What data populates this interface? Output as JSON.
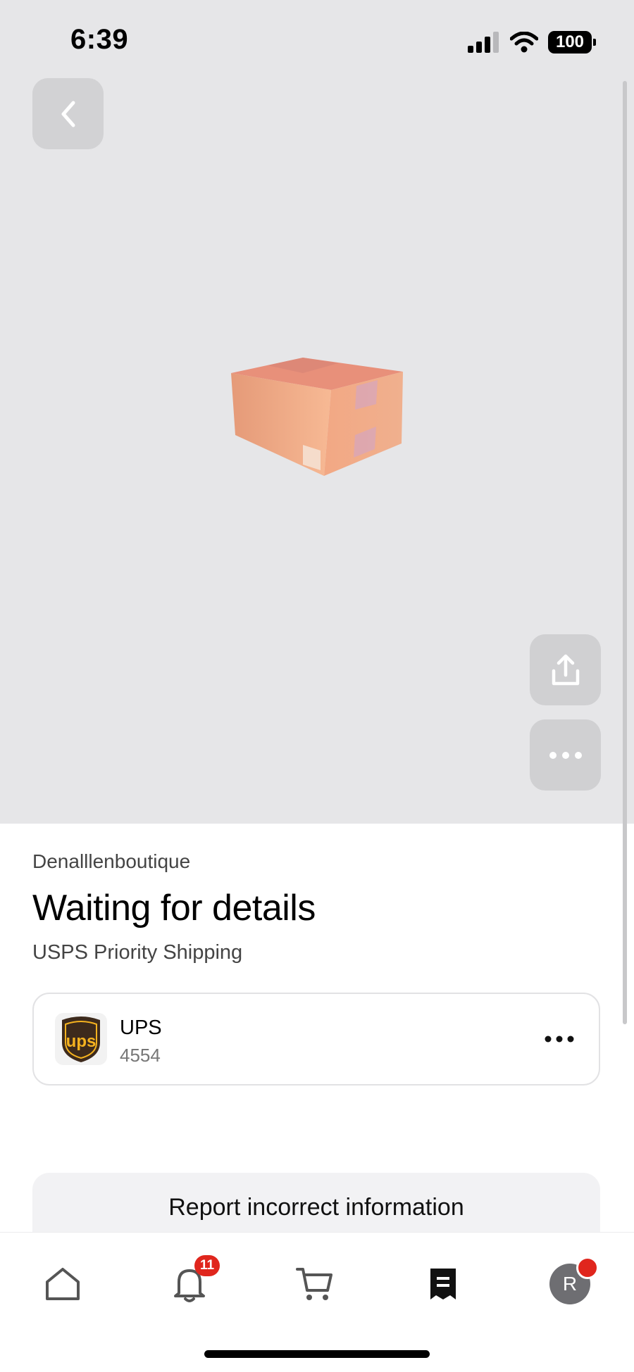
{
  "status_bar": {
    "time": "6:39",
    "battery": "100"
  },
  "header": {
    "back_icon": "chevron-left-icon",
    "share_icon": "share-icon",
    "more_icon": "ellipsis-icon"
  },
  "shipment": {
    "seller": "Denalllenboutique",
    "status": "Waiting for details",
    "shipping_method": "USPS Priority Shipping"
  },
  "carrier": {
    "name": "UPS",
    "tracking": "4554",
    "logo_text": "ups",
    "menu_icon": "ellipsis-icon"
  },
  "actions": {
    "report_label": "Report incorrect information"
  },
  "tab_bar": {
    "items": [
      {
        "icon": "home-icon"
      },
      {
        "icon": "bell-icon",
        "badge": "11"
      },
      {
        "icon": "cart-icon"
      },
      {
        "icon": "receipt-icon",
        "active": true
      },
      {
        "icon": "avatar",
        "initial": "R"
      }
    ]
  },
  "colors": {
    "hero_bg": "#e6e6e8",
    "badge": "#e0261d",
    "ups_brown": "#3d2a1c",
    "ups_gold": "#f5b21f"
  }
}
